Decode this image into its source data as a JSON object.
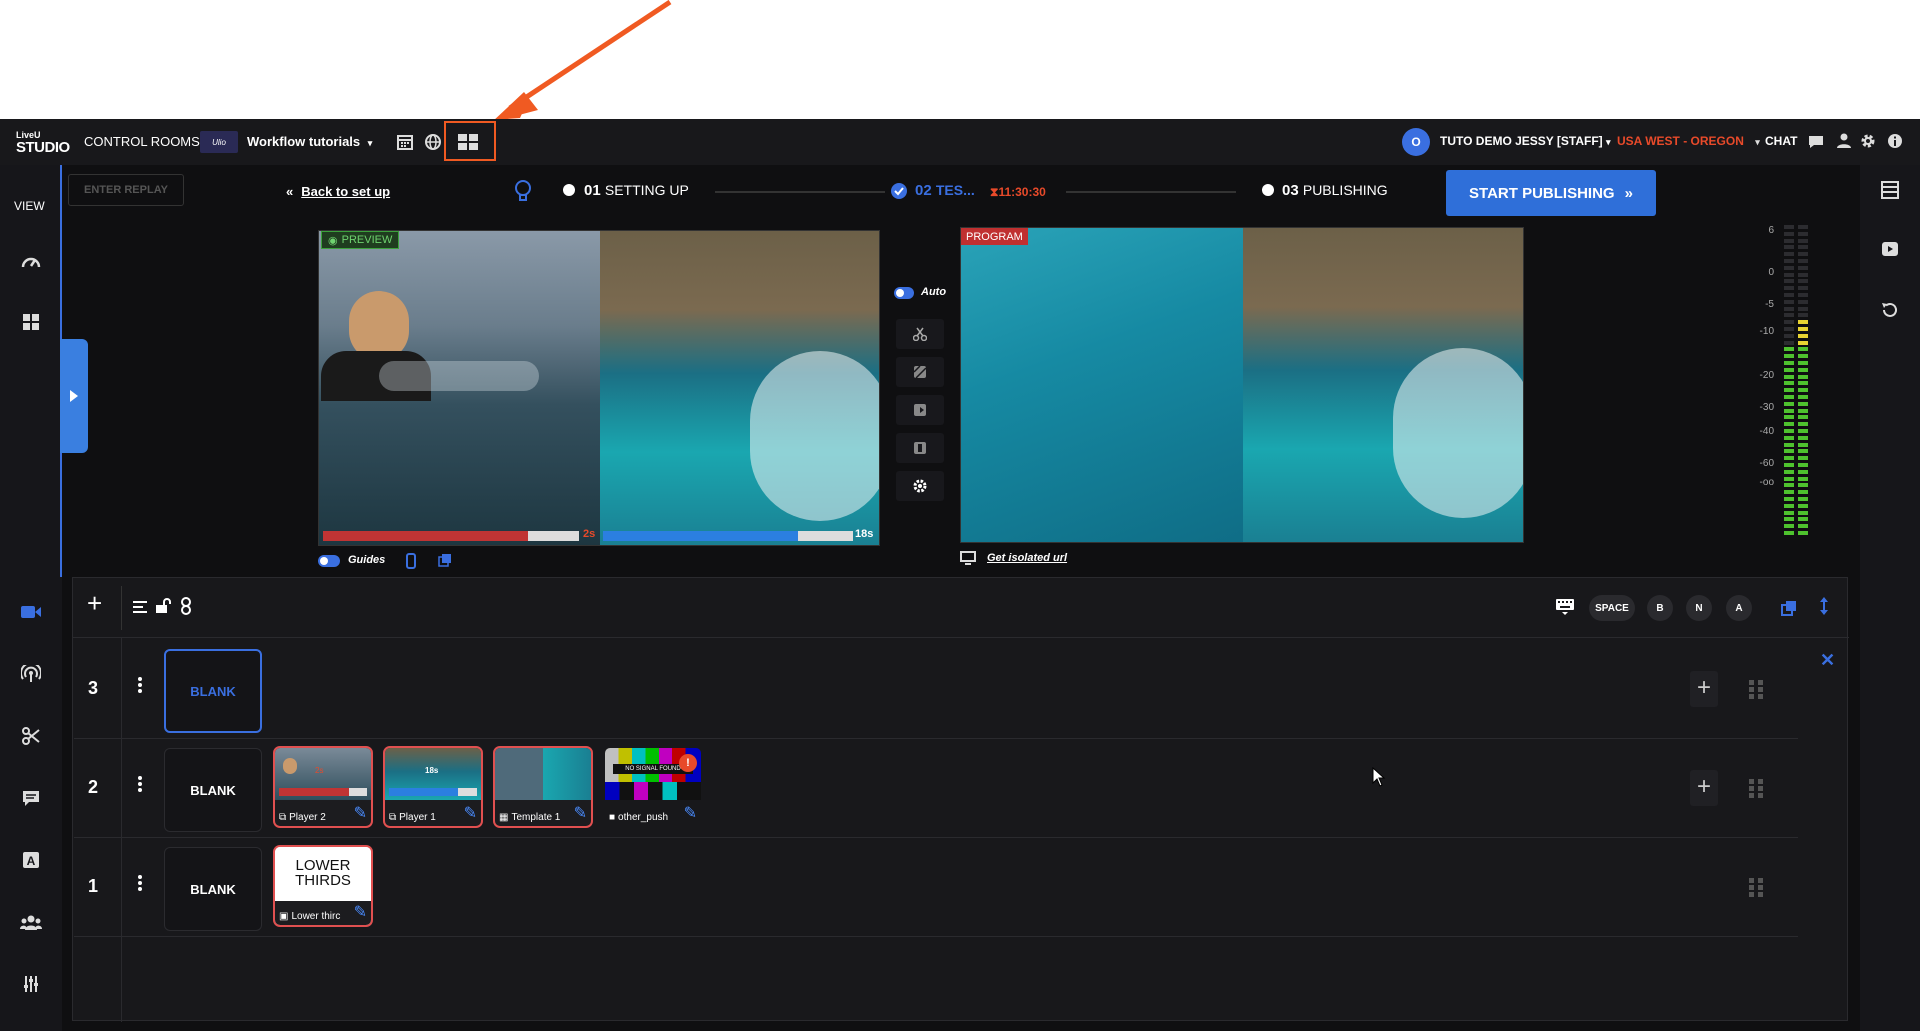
{
  "header": {
    "logo_top": "LiveU",
    "logo_main": "STUDIO",
    "control_rooms": "CONTROL ROOMS",
    "workspace": "Workflow tutorials",
    "workspace_logo": "Ulio",
    "user_initial": "O",
    "user": "TUTO DEMO JESSY [STAFF]",
    "region": "USA WEST - OREGON",
    "chat": "CHAT"
  },
  "sidebar": {
    "view_label": "VIEW"
  },
  "steps": {
    "enter_replay": "ENTER REPLAY",
    "back": "Back to set up",
    "step1_num": "01",
    "step1_label": "SETTING UP",
    "step2_num": "02",
    "step2_label": "TES...",
    "timer": "11:30:30",
    "step3_num": "03",
    "step3_label": "PUBLISHING",
    "start_publishing": "START PUBLISHING"
  },
  "preview": {
    "badge": "PREVIEW",
    "left_time": "2s",
    "left_progress": 0.8,
    "right_time": "18s",
    "right_progress": 0.78,
    "guides": "Guides"
  },
  "controls": {
    "auto": "Auto"
  },
  "program": {
    "badge": "PROGRAM",
    "isolated_url": "Get isolated url"
  },
  "audio_meter": {
    "scale": [
      "6",
      "0",
      "-5",
      "-10",
      "-20",
      "-30",
      "-40",
      "-60",
      "-oo"
    ]
  },
  "layers_toolbar": {
    "space": "SPACE",
    "b": "B",
    "n": "N",
    "a": "A"
  },
  "layers": [
    {
      "num": "3",
      "blank": "BLANK"
    },
    {
      "num": "2",
      "blank": "BLANK",
      "items": [
        "Player 2",
        "Player 1",
        "Template 1",
        "other_push"
      ],
      "player1_time": "18s",
      "player2_time": "2s",
      "nosignal_text": "NO SIGNAL FOUND"
    },
    {
      "num": "1",
      "blank": "BLANK",
      "items": [
        "Lower thirc"
      ],
      "lower_thirds_text": "LOWER THIRDS"
    }
  ],
  "colors": {
    "accent_blue": "#3a6fe0",
    "publish_blue": "#2f6fd9",
    "region_red": "#e84a2a",
    "arrow_orange": "#f05a22",
    "preview_green": "#3ba13b",
    "program_red": "#c03030"
  }
}
